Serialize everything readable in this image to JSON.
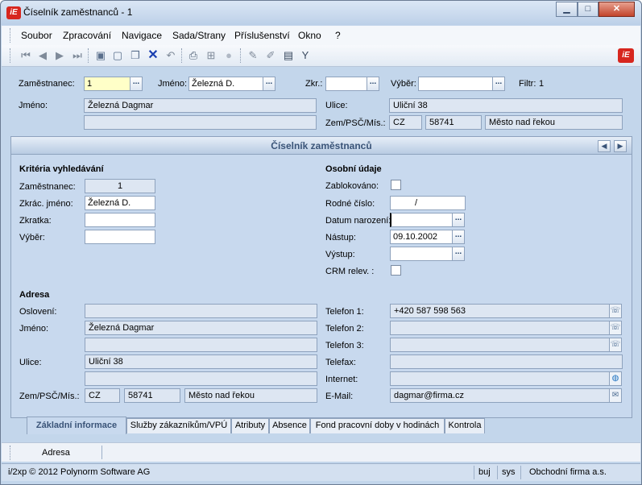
{
  "window": {
    "title": "Číselník zaměstnanců - 1",
    "logo": "iE",
    "min": "▁",
    "max": "□",
    "close": "✕"
  },
  "menu": [
    "Soubor",
    "Zpracování",
    "Navigace",
    "Sada/Strany",
    "Příslušenství",
    "Okno",
    "?"
  ],
  "toolbar": {
    "icons": [
      "first-icon",
      "prev-icon",
      "next-icon",
      "last-icon",
      "save-icon",
      "new-icon",
      "copy-icon",
      "delete-icon",
      "undo-icon",
      "print-icon",
      "tree-icon",
      "disabled-icon",
      "edit-icon",
      "edit2-icon",
      "list-icon",
      "filter-icon"
    ]
  },
  "header": {
    "zamestnanec_label": "Zaměstnanec:",
    "zamestnanec_value": "1",
    "jmeno_label": "Jméno:",
    "jmeno_value": "Železná D.",
    "zkr_label": "Zkr.:",
    "zkr_value": "",
    "vyber_label": "Výběr:",
    "vyber_value": "",
    "filtr_label": "Filtr:",
    "filtr_value": "1",
    "jmeno2_label": "Jméno:",
    "jmeno2_value": "Železná Dagmar",
    "jmeno2_line2": "",
    "ulice_label": "Ulice:",
    "ulice_value": "Uliční 38",
    "zem_label": "Zem/PSČ/Mís.:",
    "zem_value": "CZ",
    "psc_value": "58741",
    "mesto_value": "Město nad řekou",
    "dots": "..."
  },
  "panel": {
    "title": "Číselník zaměstnanců",
    "nav_prev": "◀",
    "nav_next": "▶",
    "kriteria": {
      "title": "Kritéria vyhledávání",
      "zam_label": "Zaměstnanec:",
      "zam_value": "1",
      "zkrac_label": "Zkrác. jméno:",
      "zkrac_value": "Železná D.",
      "zkratka_label": "Zkratka:",
      "zkratka_value": "",
      "vyber_label": "Výběr:",
      "vyber_value": ""
    },
    "osobni": {
      "title": "Osobní údaje",
      "zablokovano_label": "Zablokováno:",
      "rodne_label": "Rodné číslo:",
      "rodne_value": "/",
      "narozeni_label": "Datum narození:",
      "narozeni_value": "",
      "nastup_label": "Nástup:",
      "nastup_value": "09.10.2002",
      "vystup_label": "Výstup:",
      "vystup_value": "",
      "crm_label": "CRM relev. :"
    },
    "adresa": {
      "title": "Adresa",
      "osloveni_label": "Oslovení:",
      "osloveni_value": "",
      "jmeno_label": "Jméno:",
      "jmeno_value": "Železná Dagmar",
      "jmeno_line2": "",
      "ulice_label": "Ulice:",
      "ulice_value": "Uliční 38",
      "ulice_line2": "",
      "zem_label": "Zem/PSČ/Mís.:",
      "zem_value": "CZ",
      "psc_value": "58741",
      "mesto_value": "Město nad řekou"
    },
    "kontakt": {
      "tel1_label": "Telefon 1:",
      "tel1_value": "+420 587 598 563",
      "tel2_label": "Telefon 2:",
      "tel2_value": "",
      "tel3_label": "Telefon 3:",
      "tel3_value": "",
      "fax_label": "Telefax:",
      "fax_value": "",
      "internet_label": "Internet:",
      "internet_value": "",
      "email_label": "E-Mail:",
      "email_value": "dagmar@firma.cz"
    }
  },
  "tabs": [
    "Základní informace",
    "Služby zákazníkům/VPÚ",
    "Atributy",
    "Absence",
    "Fond pracovní doby v hodinách",
    "Kontrola"
  ],
  "bottom_tab": "Adresa",
  "status": {
    "copyright": "i/2xp © 2012 Polynorm Software AG",
    "user": "buj",
    "db": "sys",
    "company": "Obchodní firma a.s."
  }
}
